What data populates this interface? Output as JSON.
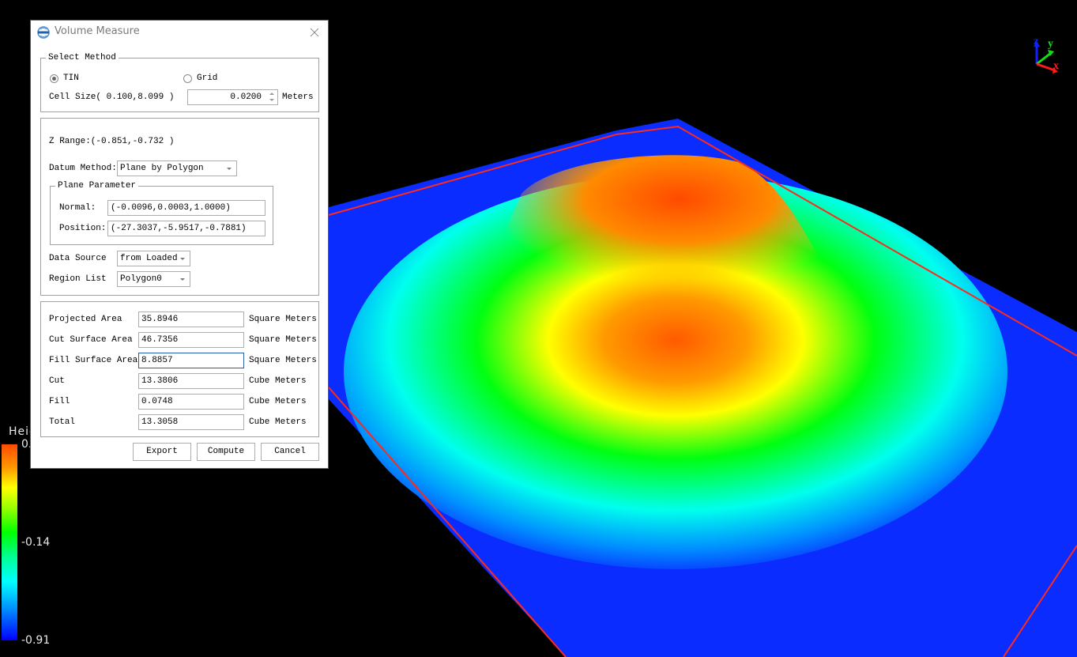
{
  "dialog": {
    "title": "Volume Measure",
    "app_icon": "lidar360-logo-icon",
    "close_icon": "close-icon",
    "select_method": {
      "group_title": "Select Method",
      "options": [
        {
          "label": "TIN",
          "checked": true
        },
        {
          "label": "Grid",
          "checked": false
        }
      ],
      "cell_size_label": "Cell Size( 0.100,8.099 )",
      "cell_size_value": "0.0200",
      "cell_size_unit": "Meters"
    },
    "datum": {
      "z_range": "Z Range:(-0.851,-0.732 )",
      "datum_method_label": "Datum Method:",
      "datum_method_value": "Plane by Polygon",
      "plane_parameter": {
        "group_title": "Plane Parameter",
        "normal_label": "Normal:",
        "normal_value": "(-0.0096,0.0003,1.0000)",
        "position_label": "Position:",
        "position_value": "(-27.3037,-5.9517,-0.7881)"
      },
      "data_source_label": "Data Source",
      "data_source_value": "from Loaded",
      "region_list_label": "Region List",
      "region_list_value": "Polygon0"
    },
    "results": [
      {
        "label": "Projected Area",
        "value": "35.8946",
        "unit": "Square Meters"
      },
      {
        "label": "Cut Surface Area",
        "value": "46.7356",
        "unit": "Square Meters"
      },
      {
        "label": "Fill Surface Area",
        "value": "8.8857",
        "unit": "Square Meters"
      },
      {
        "label": "Cut",
        "value": "13.3806",
        "unit": "Cube Meters"
      },
      {
        "label": "Fill",
        "value": "0.0748",
        "unit": "Cube Meters"
      },
      {
        "label": "Total",
        "value": "13.3058",
        "unit": "Cube Meters"
      }
    ],
    "buttons": {
      "export": "Export",
      "compute": "Compute",
      "cancel": "Cancel"
    }
  },
  "viewport": {
    "legend": {
      "title": "Height",
      "max_label": "0.",
      "mid_label": "-0.14",
      "min_label": "-0.91",
      "colors": [
        "#ff4a00",
        "#ffff00",
        "#00ff00",
        "#00ffff",
        "#0000ff"
      ]
    },
    "axes": {
      "x": "x",
      "y": "y",
      "z": "z"
    },
    "polygon_color": "#ff2a1a"
  }
}
